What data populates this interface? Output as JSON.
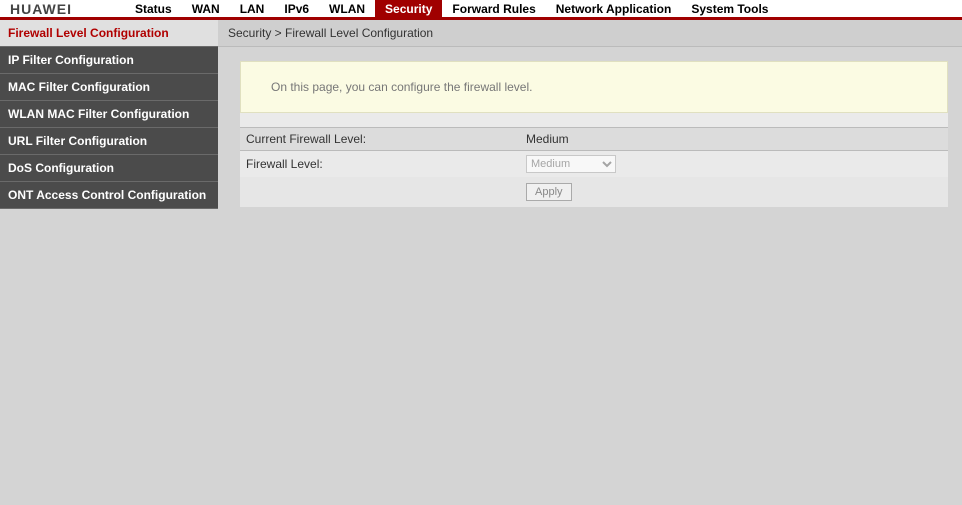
{
  "brand": "HUAWEI",
  "nav": [
    {
      "label": "Status",
      "active": false
    },
    {
      "label": "WAN",
      "active": false
    },
    {
      "label": "LAN",
      "active": false
    },
    {
      "label": "IPv6",
      "active": false
    },
    {
      "label": "WLAN",
      "active": false
    },
    {
      "label": "Security",
      "active": true
    },
    {
      "label": "Forward Rules",
      "active": false
    },
    {
      "label": "Network Application",
      "active": false
    },
    {
      "label": "System Tools",
      "active": false
    }
  ],
  "sidebar": [
    {
      "label": "Firewall Level Configuration",
      "active": true
    },
    {
      "label": "IP Filter Configuration",
      "active": false
    },
    {
      "label": "MAC Filter Configuration",
      "active": false
    },
    {
      "label": "WLAN MAC Filter Configuration",
      "active": false
    },
    {
      "label": "URL Filter Configuration",
      "active": false
    },
    {
      "label": "DoS Configuration",
      "active": false
    },
    {
      "label": "ONT Access Control Configuration",
      "active": false
    }
  ],
  "breadcrumb": "Security > Firewall Level Configuration",
  "info_text": "On this page, you can configure the firewall level.",
  "fields": {
    "current_label": "Current Firewall Level:",
    "current_value": "Medium",
    "level_label": "Firewall Level:",
    "level_selected": "Medium"
  },
  "apply_label": "Apply"
}
